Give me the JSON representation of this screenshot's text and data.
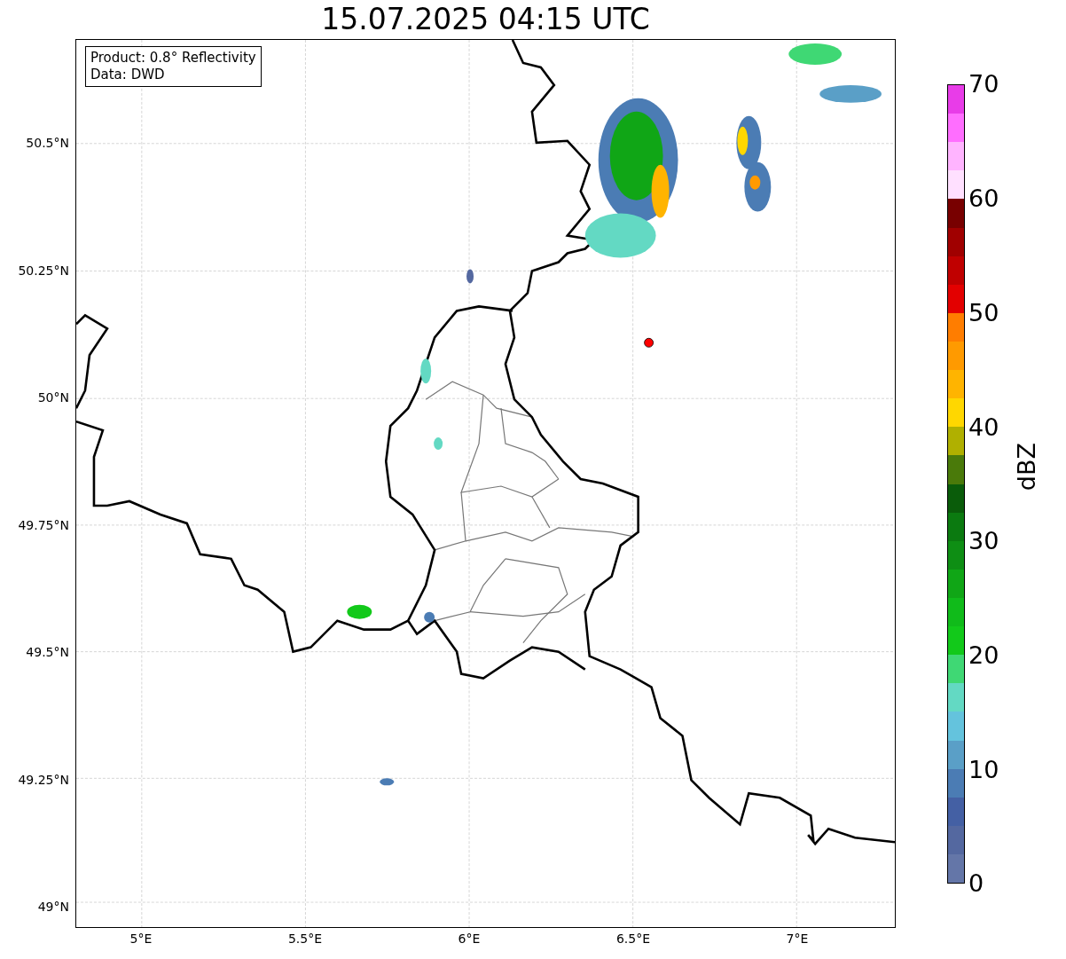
{
  "title": "15.07.2025 04:15 UTC",
  "info_box": [
    "Product: 0.8° Reflectivity",
    "Data: DWD"
  ],
  "x_ticks": [
    "5°E",
    "5.5°E",
    "6°E",
    "6.5°E",
    "7°E"
  ],
  "y_ticks": [
    "50.5°N",
    "50.25°N",
    "50°N",
    "49.75°N",
    "49.5°N",
    "49.25°N",
    "49°N"
  ],
  "colorbar": {
    "label": "dBZ",
    "ticks": [
      "70",
      "60",
      "50",
      "40",
      "30",
      "20",
      "10",
      "0"
    ],
    "bins": [
      {
        "color": "#e83ce8"
      },
      {
        "color": "#ff6eff"
      },
      {
        "color": "#ffb4ff"
      },
      {
        "color": "#ffe0ff"
      },
      {
        "color": "#780000"
      },
      {
        "color": "#a00000"
      },
      {
        "color": "#c00000"
      },
      {
        "color": "#e30000"
      },
      {
        "color": "#ff7d00"
      },
      {
        "color": "#ff9a00"
      },
      {
        "color": "#ffb400"
      },
      {
        "color": "#ffd700"
      },
      {
        "color": "#b0b000"
      },
      {
        "color": "#4a7a0a"
      },
      {
        "color": "#0a5c0a"
      },
      {
        "color": "#0b7a10"
      },
      {
        "color": "#0e8e14"
      },
      {
        "color": "#10a616"
      },
      {
        "color": "#10bb1a"
      },
      {
        "color": "#12c91a"
      },
      {
        "color": "#3fd874"
      },
      {
        "color": "#63d9c3"
      },
      {
        "color": "#64c3dd"
      },
      {
        "color": "#5a9fc7"
      },
      {
        "color": "#4b7cb4"
      },
      {
        "color": "#4460a4"
      },
      {
        "color": "#5468a0"
      },
      {
        "color": "#6476a8"
      }
    ]
  }
}
